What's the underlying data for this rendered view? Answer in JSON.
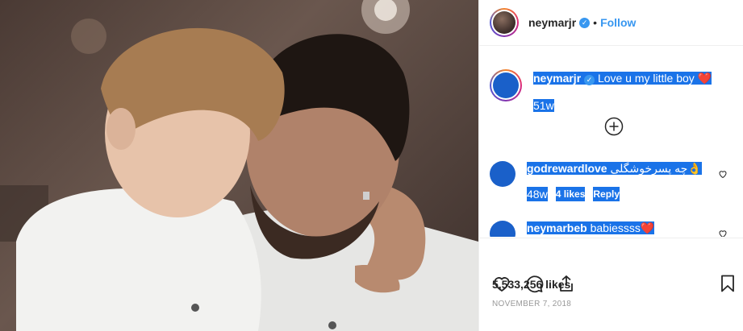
{
  "post": {
    "author": "neymarjr",
    "follow_label": "Follow",
    "dot": "•",
    "caption_author": "neymarjr",
    "caption_text": "Love u my little boy",
    "caption_emoji": "❤️",
    "caption_age": "51w",
    "likes": "5,533,256 likes",
    "date": "NOVEMBER 7, 2018"
  },
  "comments": [
    {
      "user": "godrewardlove",
      "text": "چه پسرخوشگلی👌",
      "age": "48w",
      "likes": "4 likes",
      "reply_label": "Reply"
    },
    {
      "user": "neymarbeb",
      "text": "babiessss",
      "emoji": "❤️"
    }
  ],
  "icons": {
    "verified": "✓",
    "heart": "heart-icon",
    "comment": "comment-icon",
    "share": "share-icon",
    "bookmark": "bookmark-icon",
    "plus": "plus-circle-icon"
  },
  "colors": {
    "accent": "#3897f0",
    "selection": "#1a73e8",
    "text": "#262626",
    "muted": "#999999"
  }
}
